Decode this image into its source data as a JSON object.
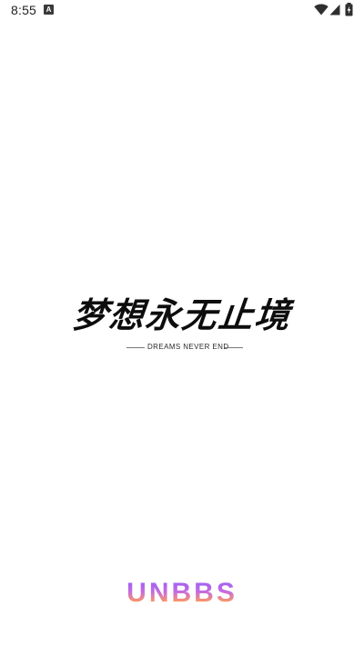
{
  "status_bar": {
    "time": "8:55",
    "notification_letter": "A",
    "icons": [
      "wifi-icon",
      "signal-icon",
      "battery-charging-icon"
    ]
  },
  "splash": {
    "slogan": "梦想永无止境",
    "slogan_sub": "DREAMS NEVER END"
  },
  "brand": {
    "name": "UNBBS",
    "gradient_colors": [
      "#8a5cff",
      "#c56be0",
      "#ff9a5a",
      "#ffb84a"
    ]
  },
  "colors": {
    "background": "#ffffff",
    "text_dark": "#0d0d0d"
  }
}
